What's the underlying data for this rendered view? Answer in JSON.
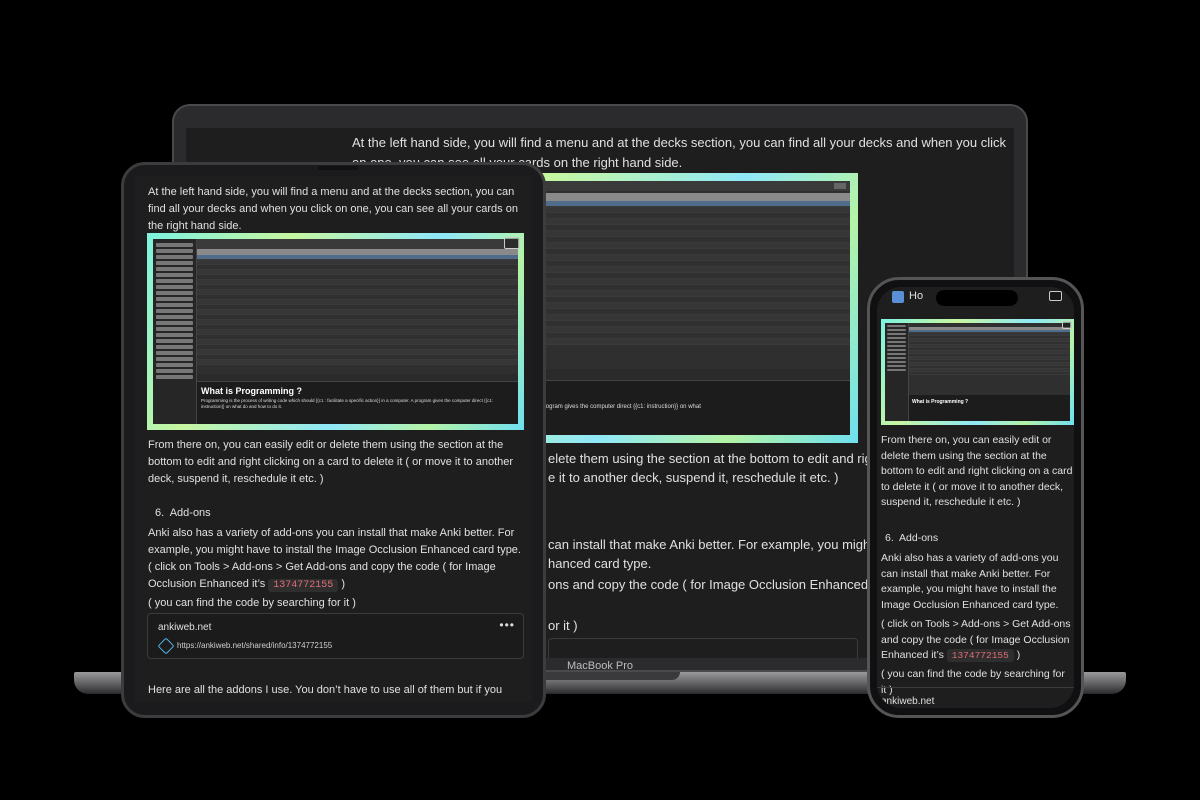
{
  "laptop": {
    "label": "MacBook Pro",
    "intro": "At the left hand side, you will find a menu and at the decks section, you can find all your decks and when you click on one, you can see all your cards on the right hand side.",
    "partial_lines": [
      "elete them using the section at the bottom to edit and right",
      "e it to another deck, suspend it, reschedule it etc. )",
      "can install that make Anki better. For example, you might",
      "hanced card type.",
      "ons and copy the code ( for Image Occlusion Enhanced it’s",
      "or it )"
    ],
    "card_title_partial": "?",
    "card_text_partial": "de which should {{c1 : facilitate a specific action}} in a computer. A program gives the computer direct {{c1: instruction}} on what"
  },
  "tablet": {
    "intro": "At the left hand side, you will find a menu and at the decks section, you can find all your decks and when you click on one, you can see all your cards on the right hand side.",
    "edit_text": "From there on, you can easily edit or delete them using the section at the bottom to edit and right clicking on a card to delete it ( or move it to another deck, suspend it, reschedule it etc. )",
    "section_number": "6.",
    "section_title": "Add-ons",
    "addons_text": "Anki also has a variety of add-ons you can install that make Anki better. For example, you might have to install the Image Occlusion Enhanced card type.",
    "click_text_1": "( click on Tools > Add-ons > Get Add-ons and copy the code ( for Image Occlusion Enhanced it’s",
    "code": "1374772155",
    "click_text_2": ")",
    "search_hint": "( you can find the code by searching for it )",
    "link_card": {
      "domain": "ankiweb.net",
      "url": "https://ankiweb.net/shared/info/1374772155",
      "menu": "•••"
    },
    "footer_text": "Here are all the addons I use. You don’t have to use all of them but if you come",
    "card_title": "What is Programming ?",
    "card_text": "Programming is the process of writing code which should {{c1 : facilitate a specific action}} in a computer. A program gives the computer direct {{c1: instruction}} on what do and how to do it."
  },
  "phone": {
    "title_partial": "Ho",
    "edit_text": "From there on, you can easily edit or delete them using the section at the bottom to edit and right clicking on a card to delete it ( or move it to another deck, suspend it, reschedule it etc. )",
    "section_number": "6.",
    "section_title": "Add-ons",
    "addons_text": "Anki also has a variety of add-ons you can install that make Anki better. For example, you might have to install the Image Occlusion Enhanced card type.",
    "click_text_1": "( click on Tools > Add-ons > Get Add-ons and copy the code ( for Image Occlusion Enhanced it’s",
    "code": "1374772155",
    "click_text_2": ")",
    "search_hint": "( you can find the code by searching for it )",
    "link_domain": "ankiweb.net",
    "card_title": "What is Programming ?"
  },
  "colors": {
    "background": "#000000",
    "content_bg": "#1e1e1e",
    "code_text": "#e06c75",
    "screenshot_gradient": [
      "#7cf3e0",
      "#c6f6a0",
      "#8fe8f8"
    ]
  }
}
